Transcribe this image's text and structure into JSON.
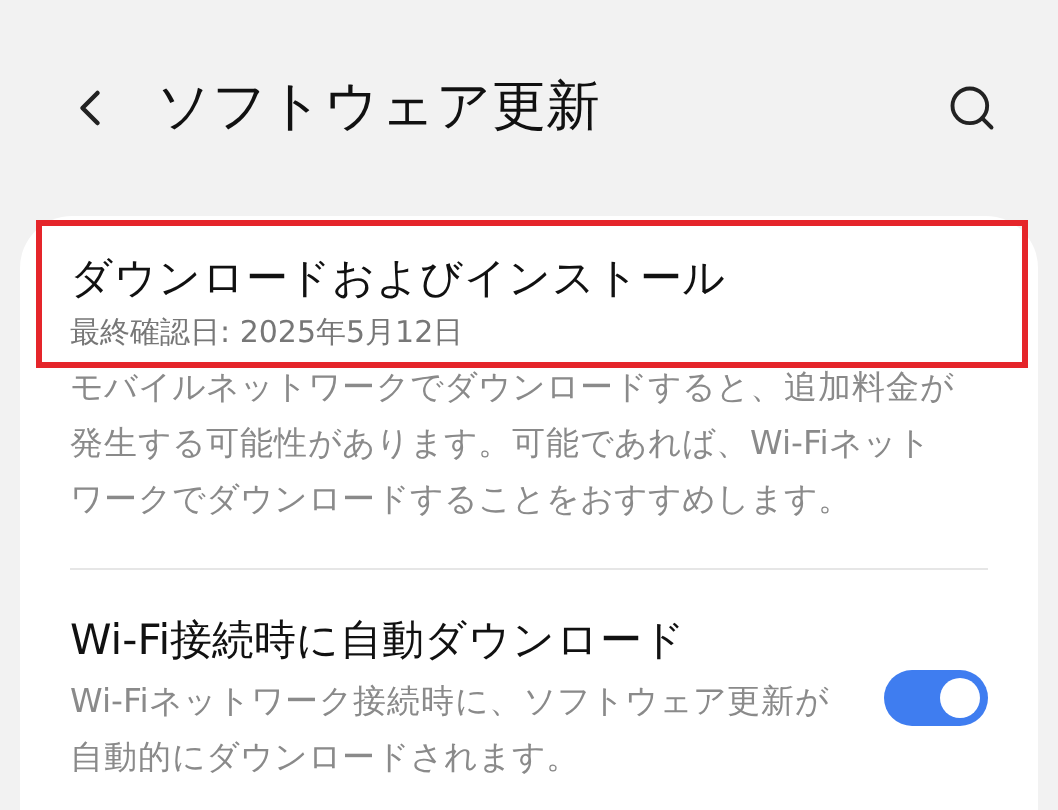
{
  "header": {
    "title": "ソフトウェア更新"
  },
  "items": [
    {
      "kind": "action",
      "title": "ダウンロードおよびインストール",
      "subtitle": "最終確認日: 2025年5月12日",
      "description": "モバイルネットワークでダウンロードすると、追加料金が発生する可能性があります。可能であれば、Wi-Fiネットワークでダウンロードすることをおすすめします。",
      "highlighted": true
    },
    {
      "kind": "switch",
      "title": "Wi-Fi接続時に自動ダウンロード",
      "description": "Wi-Fiネットワーク接続時に、ソフトウェア更新が自動的にダウンロードされます。",
      "on": true,
      "highlighted": false
    }
  ]
}
